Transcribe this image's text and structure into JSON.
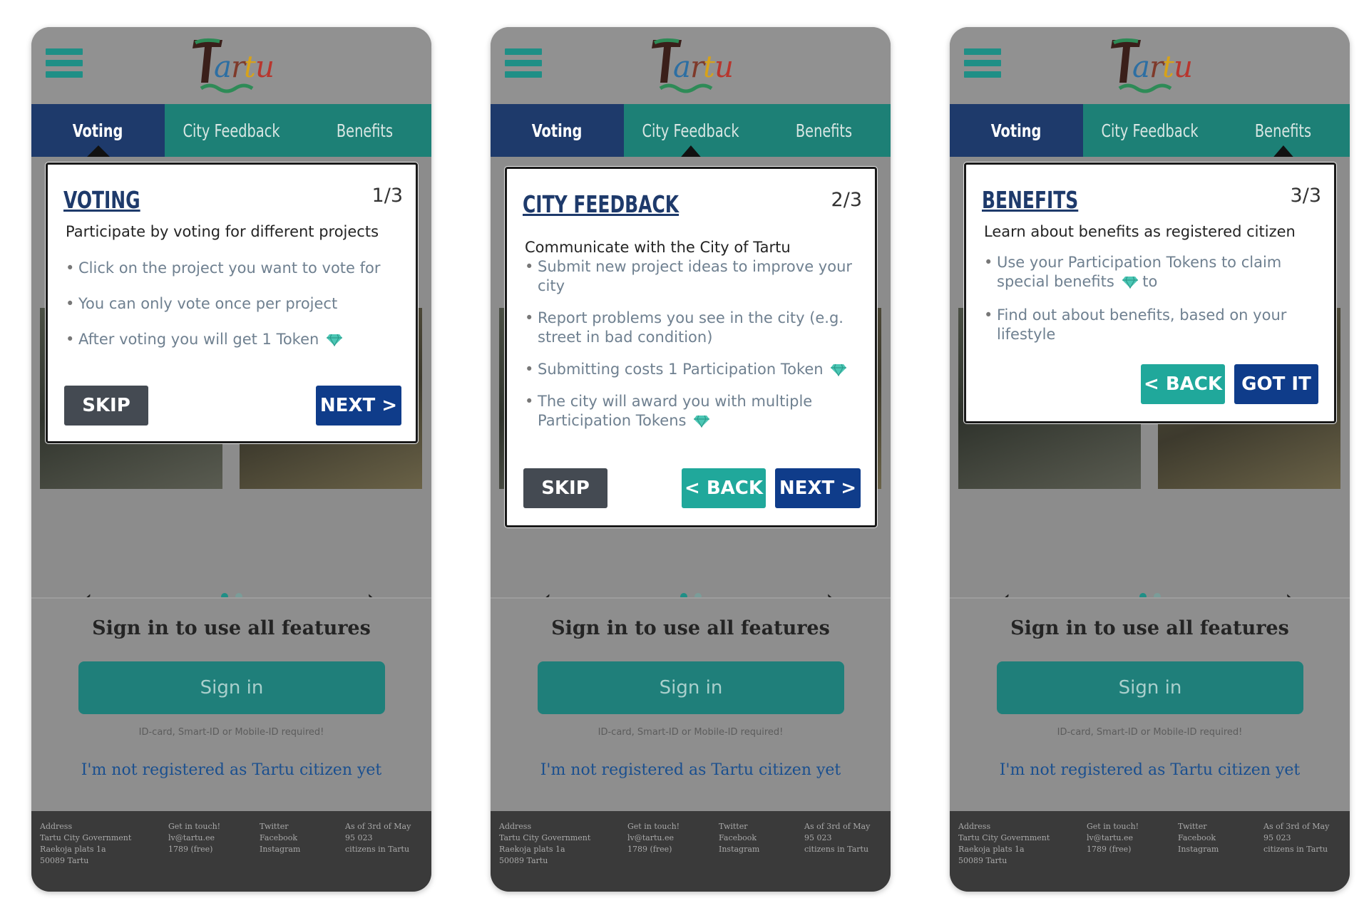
{
  "app": {
    "logo_text": "Tartu",
    "tabs": [
      "Voting",
      "City Feedback",
      "Benefits"
    ],
    "carousel_prev": "‹",
    "carousel_next": "›",
    "signin_title": "Sign in to use all features",
    "signin_button": "Sign in",
    "signin_note": "ID-card, Smart-ID or Mobile-ID required!",
    "register_link": "I'm not registered as Tartu citizen yet",
    "footer": {
      "col1": "Address\nTartu City Government\nRaekoja plats 1a\n50089 Tartu",
      "col2": "Get in touch!\nlv@tartu.ee\n1789 (free)",
      "col3": "Twitter\nFacebook\nInstagram",
      "col4": "As of 3rd of May\n95 023\ncitizens in Tartu"
    }
  },
  "colors": {
    "teal": "#1d8076",
    "navy": "#1e3a6b",
    "button_next": "#0f3c8a",
    "button_back": "#20a89b",
    "button_skip": "#444a52"
  },
  "screens": [
    {
      "title": "VOTING",
      "step": "1/3",
      "intro": "Participate by voting for different projects",
      "bullets": [
        "Click on the project you want to vote for",
        "You can only vote once per project",
        "After voting you will get 1 Token"
      ],
      "skip": "SKIP",
      "next": "NEXT >"
    },
    {
      "title": "CITY FEEDBACK",
      "step": "2/3",
      "intro": "Communicate with the City of Tartu",
      "bullets": [
        "Submit new project ideas to improve your city",
        "Report problems you see in the city (e.g. street in bad condition)",
        "Submitting costs 1 Participation Token",
        "The city will award you with multiple Participation Tokens"
      ],
      "skip": "SKIP",
      "back": "< BACK",
      "next": "NEXT >"
    },
    {
      "title": "BENEFITS",
      "step": "3/3",
      "intro": "Learn about benefits as registered citizen",
      "bullets": [
        "Use your Participation Tokens to claim special benefits",
        "Find out about benefits, based on your lifestyle"
      ],
      "bullet1_suffix": "to",
      "back": "< BACK",
      "gotit": "GOT IT"
    }
  ]
}
